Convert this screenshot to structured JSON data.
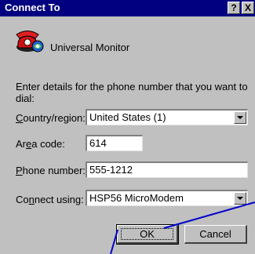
{
  "window": {
    "title": "Connect To",
    "help_glyph": "?",
    "close_glyph": "X"
  },
  "app": {
    "name": "Universal Monitor",
    "icon": "telephone-icon"
  },
  "instructions": "Enter details for the phone number that you want to dial:",
  "fields": {
    "country": {
      "accel": "C",
      "label": "ountry/region:",
      "value": "United States (1)"
    },
    "area": {
      "label_pre": "Ar",
      "accel": "e",
      "label_post": "a code:",
      "value": "614"
    },
    "phone": {
      "accel": "P",
      "label": "hone number:",
      "value": "555-1212"
    },
    "connect": {
      "label_pre": "Co",
      "accel": "n",
      "label_post": "nect using:",
      "value": "HSP56 MicroModem"
    }
  },
  "buttons": {
    "ok": "OK",
    "cancel": "Cancel"
  },
  "colors": {
    "titlebar": "#000080",
    "face": "#c0c0c0",
    "callout": "#0000cc"
  }
}
